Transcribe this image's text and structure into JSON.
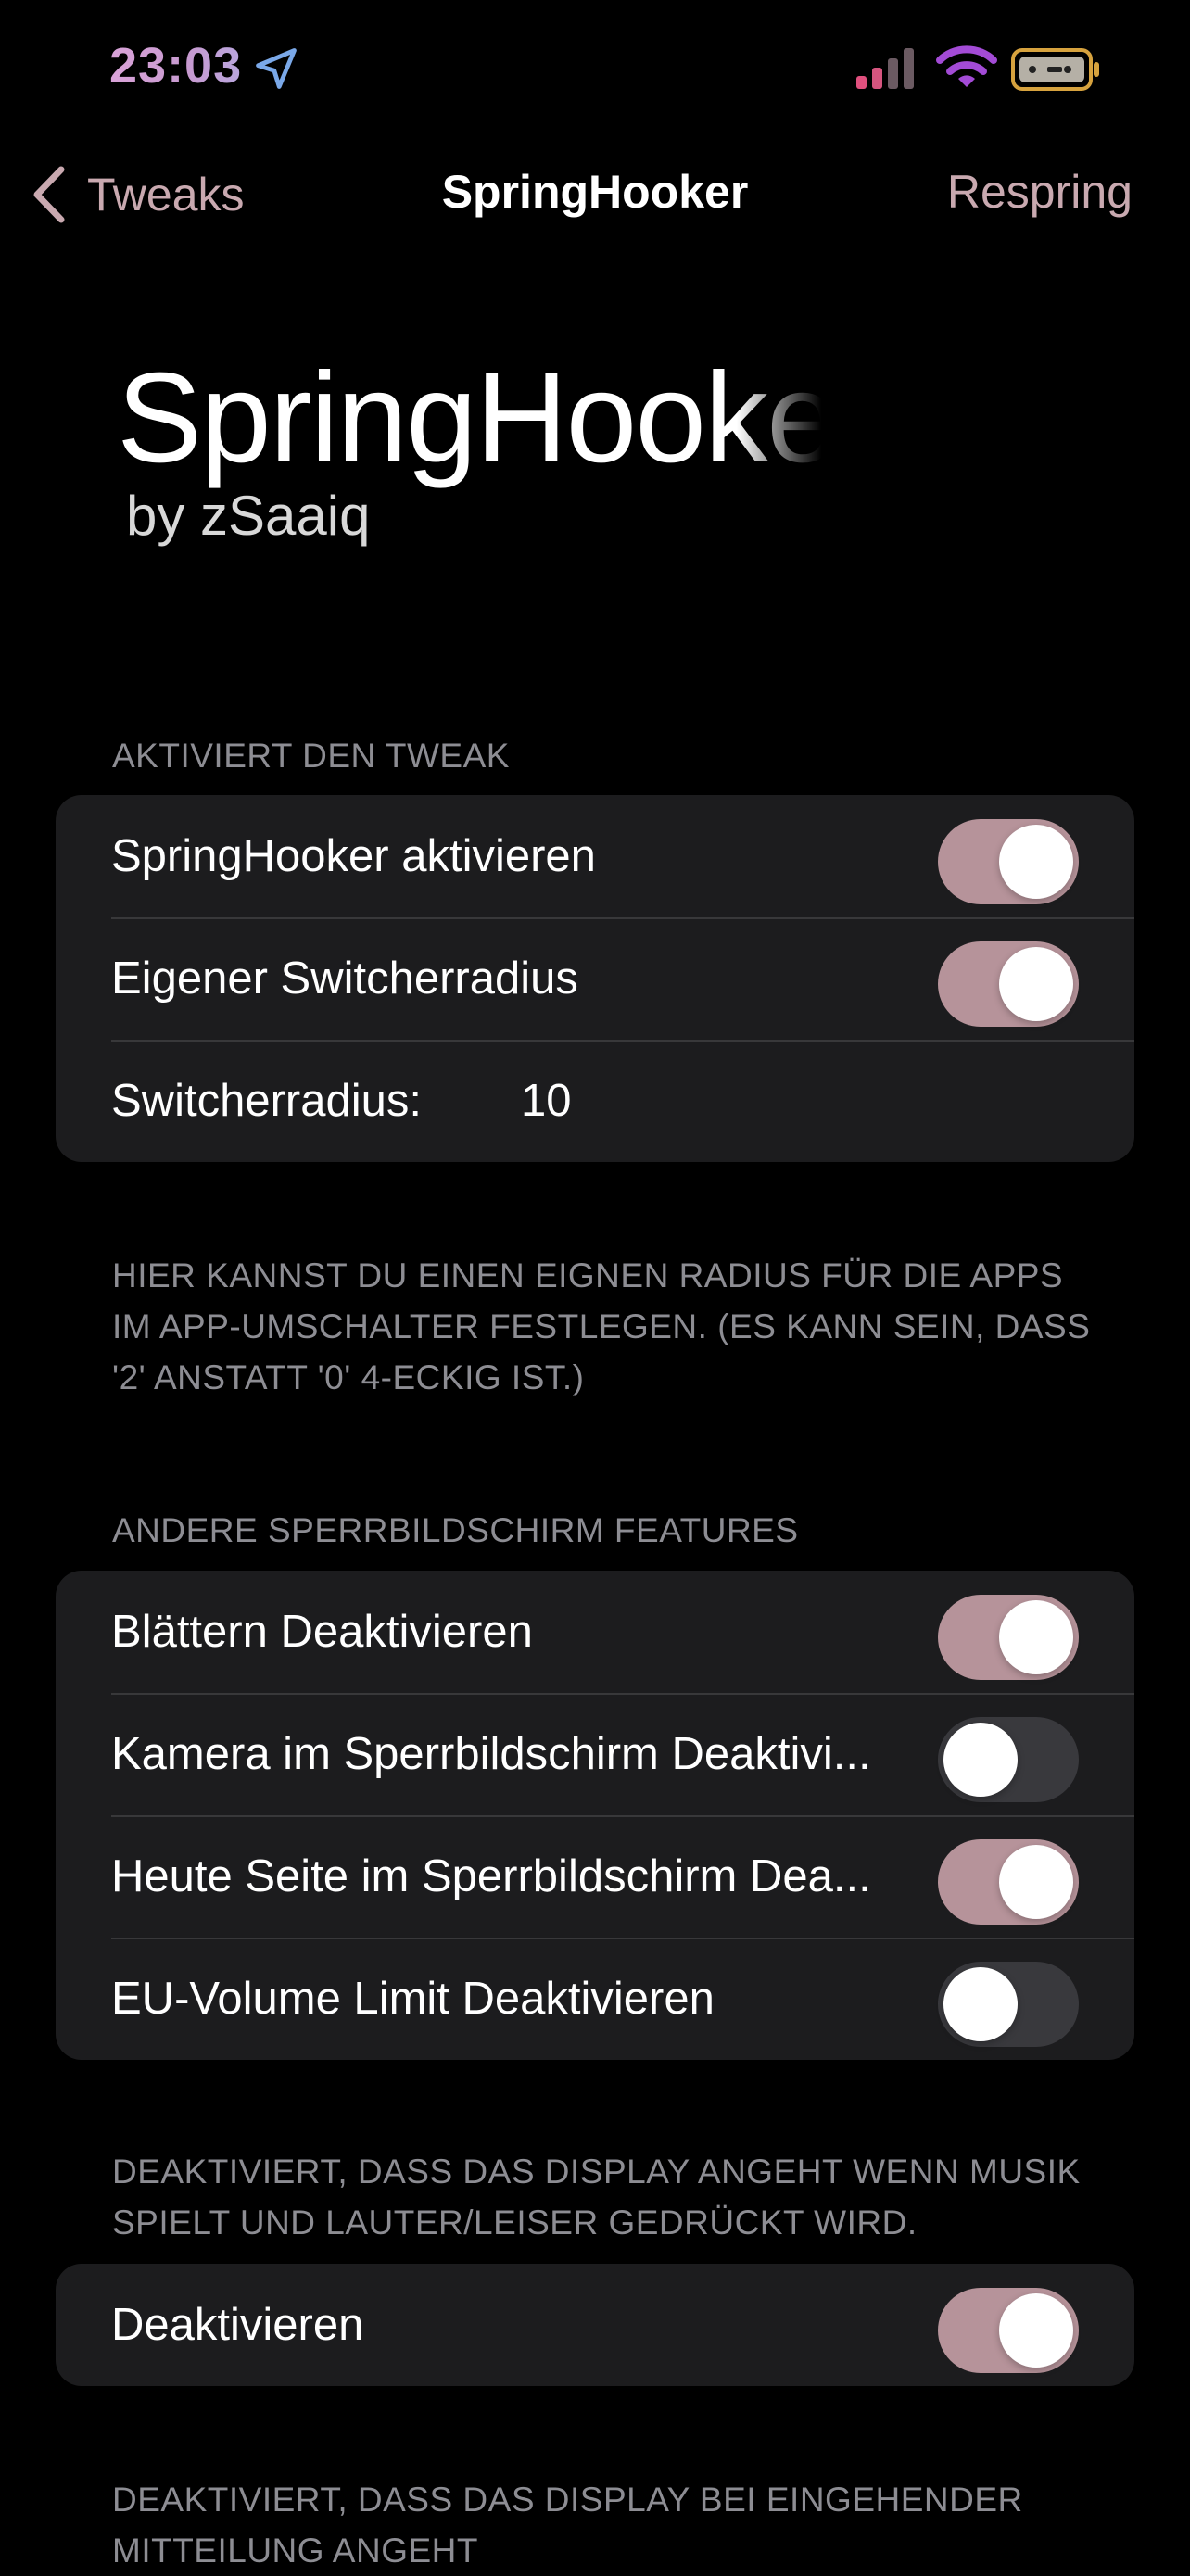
{
  "status_bar": {
    "time": "23:03"
  },
  "nav": {
    "back_label": "Tweaks",
    "title": "SpringHooker",
    "respring_label": "Respring"
  },
  "header": {
    "title": "SpringHooker",
    "subtitle": "by zSaaiq"
  },
  "sections": [
    {
      "header": "AKTIVIERT DEN TWEAK",
      "rows": [
        {
          "label": "SpringHooker aktivieren",
          "toggle": true
        },
        {
          "label": "Eigener Switcherradius",
          "toggle": true
        },
        {
          "label": "Switcherradius:",
          "value": "10"
        }
      ],
      "footer": "HIER KANNST DU EINEN EIGNEN RADIUS FÜR DIE APPS IM APP-UMSCHALTER FESTLEGEN. (ES KANN SEIN, DASS '2' ANSTATT '0' 4-ECKIG IST.)"
    },
    {
      "header": "ANDERE SPERRBILDSCHIRM FEATURES",
      "rows": [
        {
          "label": "Blättern Deaktivieren",
          "toggle": true
        },
        {
          "label": "Kamera im Sperrbildschirm Deaktivi...",
          "toggle": false
        },
        {
          "label": "Heute Seite im Sperrbildschirm Dea...",
          "toggle": true
        },
        {
          "label": "EU-Volume Limit Deaktivieren",
          "toggle": false
        }
      ]
    },
    {
      "header": "DEAKTIVIERT, DASS DAS DISPLAY ANGEHT WENN MUSIK SPIELT UND LAUTER/LEISER GEDRÜCKT WIRD.",
      "rows": [
        {
          "label": "Deaktivieren",
          "toggle": true
        }
      ]
    },
    {
      "header": "DEAKTIVIERT, DASS DAS DISPLAY BEI EINGEHENDER MITTEILUNG ANGEHT"
    }
  ],
  "colors": {
    "accent": "#c9a9b0",
    "toggle_on": "#b6939a",
    "toggle_off": "#39393d",
    "group_bg": "#1c1c1e",
    "section_text": "#8d8d93"
  },
  "icons": {
    "location": "location-arrow-icon",
    "signal": "cellular-signal-icon",
    "wifi": "wifi-icon",
    "battery": "battery-icon",
    "back": "chevron-left-icon"
  }
}
